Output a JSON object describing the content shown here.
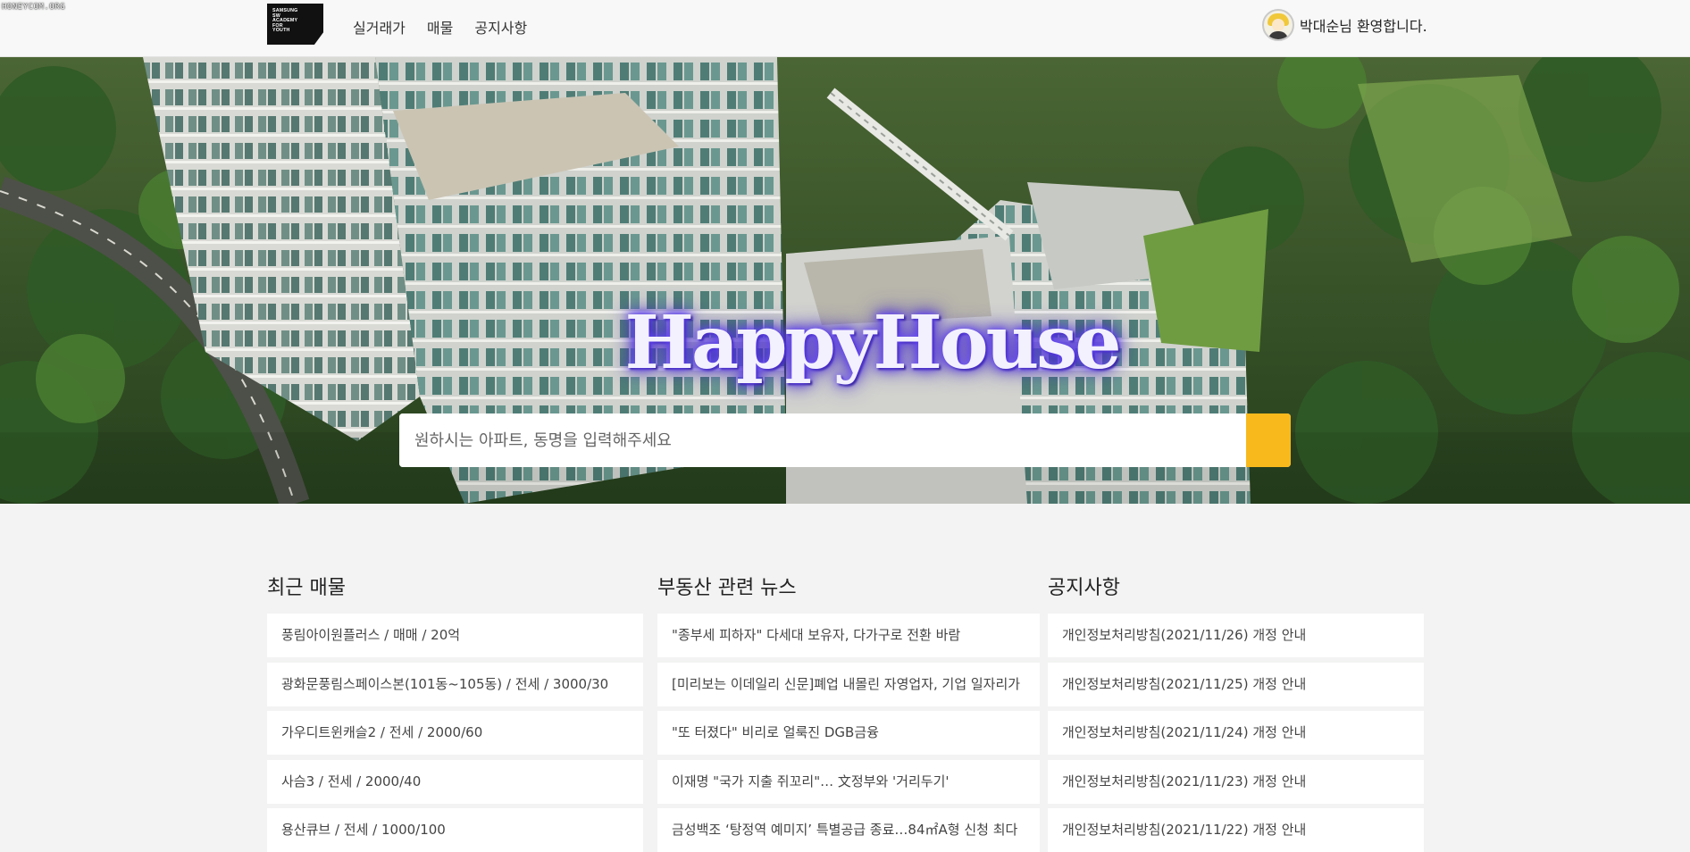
{
  "watermark": "HONEYCOM.ORG",
  "nav": {
    "logo_text": [
      "SAMSUNG",
      "SW",
      "ACADEMY",
      "FOR",
      "YOUTH"
    ],
    "links": [
      {
        "label": "실거래가"
      },
      {
        "label": "매물"
      },
      {
        "label": "공지사항"
      }
    ],
    "welcome": "박대순님 환영합니다."
  },
  "hero": {
    "title": "HappyHouse",
    "search": {
      "placeholder": "원하시는 아파트, 동명을 입력해주세요",
      "value": ""
    }
  },
  "sections": [
    {
      "title": "최근 매물",
      "items": [
        "풍림아이원플러스 / 매매 / 20억",
        "광화문풍림스페이스본(101동~105동) / 전세 / 3000/30",
        "가우디트윈캐슬2 / 전세 / 2000/60",
        "사슴3 / 전세 / 2000/40",
        "용산큐브 / 전세 / 1000/100"
      ]
    },
    {
      "title": "부동산 관련 뉴스",
      "items": [
        "\"종부세 피하자\" 다세대 보유자, 다가구로 전환 바람",
        "[미리보는 이데일리 신문]폐업 내몰린 자영업자, 기업 일자리가",
        "\"또 터졌다\" 비리로 얼룩진 DGB금융",
        "이재명 \"국가 지출 쥐꼬리\"… 文정부와 '거리두기'",
        "금성백조 ‘탕정역 예미지’ 특별공급 종료…84㎡A형 신청 최다"
      ]
    },
    {
      "title": "공지사항",
      "items": [
        "개인정보처리방침(2021/11/26) 개정 안내",
        "개인정보처리방침(2021/11/25) 개정 안내",
        "개인정보처리방침(2021/11/24) 개정 안내",
        "개인정보처리방침(2021/11/23) 개정 안내",
        "개인정보처리방침(2021/11/22) 개정 안내"
      ]
    }
  ],
  "colors": {
    "search_button": "#f8b91c",
    "title_glow": "#4b2bd9",
    "page_background": "#f2f3f2"
  },
  "icons": {
    "search_button": "search-icon",
    "user": "avatar-icon"
  }
}
